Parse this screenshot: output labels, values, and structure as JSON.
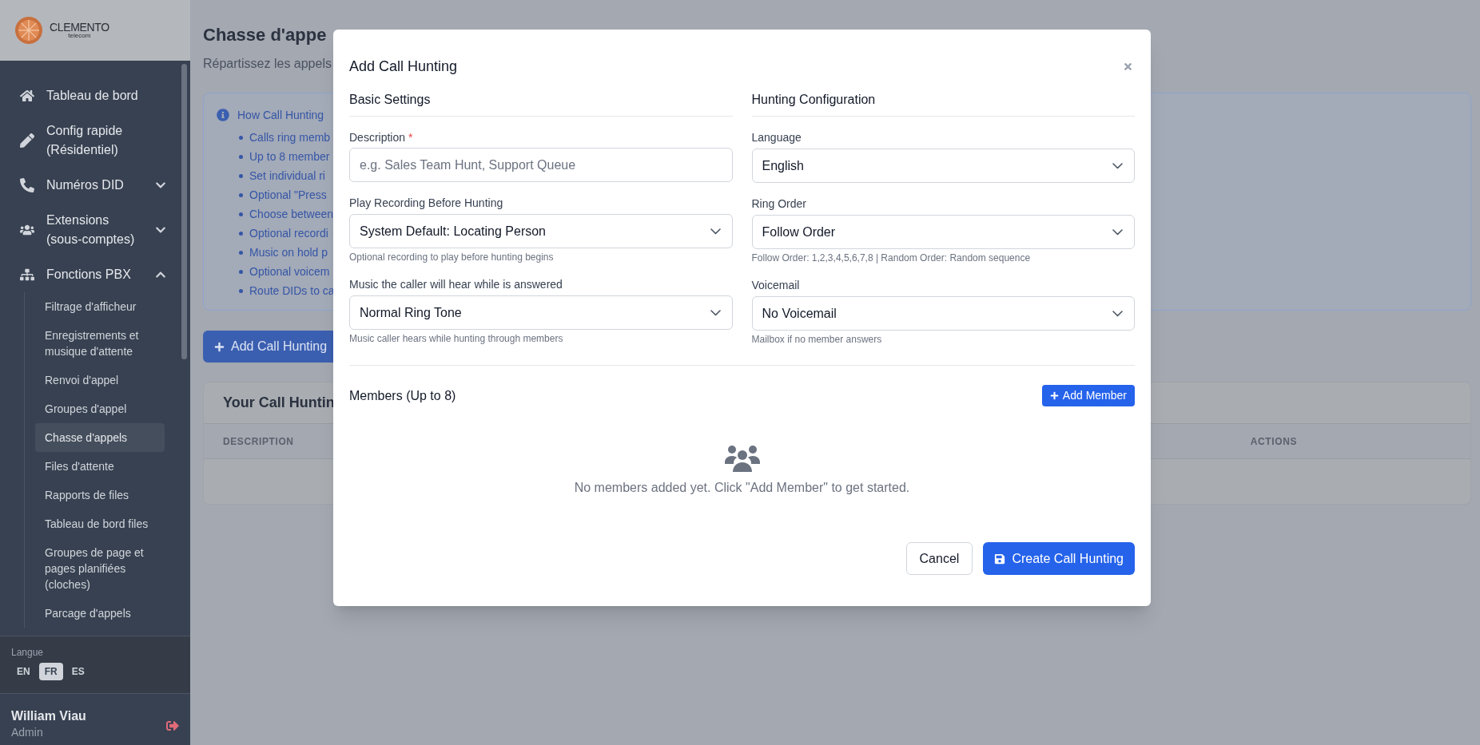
{
  "sidebar": {
    "logo": {
      "name": "CLEMENTO",
      "tagline": "telecom"
    },
    "items": [
      {
        "kind": "link",
        "label": "Tableau de bord"
      },
      {
        "kind": "link",
        "label": "Config rapide (Résidentiel)"
      },
      {
        "kind": "group",
        "label": "Numéros DID",
        "expanded": false
      },
      {
        "kind": "group",
        "label": "Extensions (sous-comptes)",
        "expanded": false
      },
      {
        "kind": "group",
        "label": "Fonctions PBX",
        "expanded": true,
        "children": [
          {
            "label": "Filtrage d'afficheur",
            "selected": false
          },
          {
            "label": "Enregistrements et musique d'attente",
            "selected": false
          },
          {
            "label": "Renvoi d'appel",
            "selected": false
          },
          {
            "label": "Groupes d'appel",
            "selected": false
          },
          {
            "label": "Chasse d'appels",
            "selected": true
          },
          {
            "label": "Files d'attente",
            "selected": false
          },
          {
            "label": "Rapports de files",
            "selected": false
          },
          {
            "label": "Tableau de bord files",
            "selected": false
          },
          {
            "label": "Groupes de page et pages planifiées (cloches)",
            "selected": false
          },
          {
            "label": "Parcage d'appels",
            "selected": false
          }
        ]
      }
    ],
    "language": {
      "label": "Langue",
      "options": [
        {
          "label": "EN",
          "selected": false
        },
        {
          "label": "FR",
          "selected": true
        },
        {
          "label": "ES",
          "selected": false
        }
      ]
    },
    "user": {
      "name": "William Viau",
      "role": "Admin"
    }
  },
  "page": {
    "title": "Chasse d'appe",
    "subtitle": "Répartissez les appels",
    "info": {
      "title": "How Call Hunting",
      "items": [
        "Calls ring memb",
        "Up to 8 member",
        "Set individual ri",
        "Optional \"Press",
        "Choose between",
        "Optional recordi",
        "Music on hold p",
        "Optional voicem",
        "Route DIDs to ca"
      ]
    },
    "add_button": "Add Call Hunting",
    "table": {
      "title": "Your Call Huntin",
      "columns": [
        "DESCRIPTION",
        "ACTIONS"
      ]
    }
  },
  "modal": {
    "title": "Add Call Hunting",
    "sections": [
      {
        "heading": "Basic Settings",
        "fields": [
          {
            "kind": "text",
            "label": "Description",
            "required_mark": "*",
            "placeholder": "e.g. Sales Team Hunt, Support Queue"
          },
          {
            "kind": "select",
            "label": "Play Recording Before Hunting",
            "value": "System Default: Locating Person",
            "help": "Optional recording to play before hunting begins"
          },
          {
            "kind": "select",
            "label": "Music the caller will hear while is answered",
            "value": "Normal Ring Tone",
            "help": "Music caller hears while hunting through members"
          }
        ]
      },
      {
        "heading": "Hunting Configuration",
        "fields": [
          {
            "kind": "select",
            "label": "Language",
            "value": "English"
          },
          {
            "kind": "select",
            "label": "Ring Order",
            "value": "Follow Order",
            "help": "Follow Order: 1,2,3,4,5,6,7,8 | Random Order: Random sequence"
          },
          {
            "kind": "select",
            "label": "Voicemail",
            "value": "No Voicemail",
            "help": "Mailbox if no member answers"
          }
        ]
      }
    ],
    "members": {
      "heading": "Members (Up to 8)",
      "add_button": "Add Member",
      "empty_text": "No members added yet. Click \"Add Member\" to get started."
    },
    "buttons": [
      {
        "kind": "secondary",
        "label": "Cancel"
      },
      {
        "kind": "primary",
        "label": "Create Call Hunting"
      }
    ]
  }
}
